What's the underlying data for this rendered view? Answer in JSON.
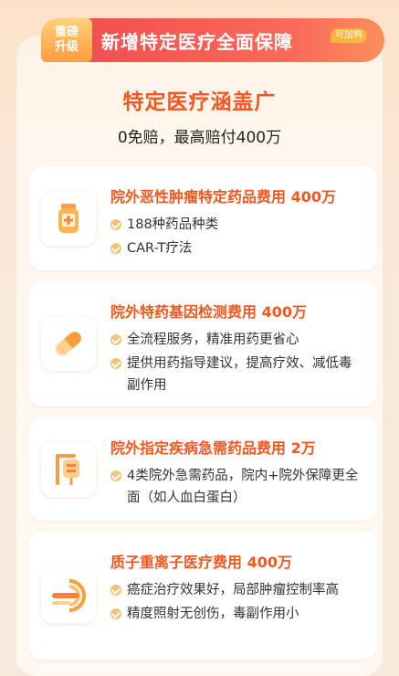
{
  "header": {
    "badge_line1": "重磅",
    "badge_line2": "升级",
    "title": "新增特定医疗全面保障",
    "addon": "可加购"
  },
  "main": {
    "title": "特定医疗涵盖广",
    "subtitle": "0免赔，最高赔付400万"
  },
  "cards": [
    {
      "title": "院外恶性肿瘤特定药品费用 400万",
      "icon": "medicine-bottle-icon",
      "bullets": [
        "188种药品种类",
        "CAR-T疗法"
      ]
    },
    {
      "title": "院外特药基因检测费用 400万",
      "icon": "pill-capsule-icon",
      "bullets": [
        "全流程服务，精准用药更省心",
        "提供用药指导建议，提高疗效、减低毒副作用"
      ]
    },
    {
      "title": "院外指定疾病急需药品费用 2万",
      "icon": "iv-drip-icon",
      "bullets": [
        "4类院外急需药品，院内+院外保障更全面（如人血白蛋白）"
      ]
    },
    {
      "title": "质子重离子医疗费用 400万",
      "icon": "proton-scanner-icon",
      "bullets": [
        "癌症治疗效果好，局部肿瘤控制率高",
        "精度照射无创伤，毒副作用小"
      ]
    }
  ],
  "colors": {
    "accent": "#f2581f",
    "header_red": "#f24f4f",
    "badge_gold": "#ffb53d",
    "check": "#f6c27a"
  }
}
